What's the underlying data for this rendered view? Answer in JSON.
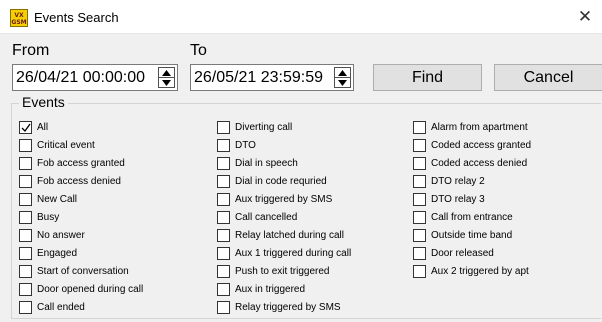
{
  "window": {
    "title": "Events Search",
    "app_icon_text": [
      "VX",
      "GSM"
    ]
  },
  "from": {
    "label": "From",
    "value": "26/04/21 00:00:00"
  },
  "to": {
    "label": "To",
    "value": "26/05/21 23:59:59"
  },
  "buttons": {
    "find": "Find",
    "cancel": "Cancel"
  },
  "events": {
    "title": "Events",
    "columns": [
      [
        {
          "label": "All",
          "checked": true
        },
        {
          "label": "Critical event",
          "checked": false
        },
        {
          "label": "Fob access granted",
          "checked": false
        },
        {
          "label": "Fob access denied",
          "checked": false
        },
        {
          "label": "New Call",
          "checked": false
        },
        {
          "label": "Busy",
          "checked": false
        },
        {
          "label": "No answer",
          "checked": false
        },
        {
          "label": "Engaged",
          "checked": false
        },
        {
          "label": "Start of conversation",
          "checked": false
        },
        {
          "label": "Door opened during call",
          "checked": false
        },
        {
          "label": "Call ended",
          "checked": false
        }
      ],
      [
        {
          "label": "Diverting call",
          "checked": false
        },
        {
          "label": "DTO",
          "checked": false
        },
        {
          "label": "Dial in speech",
          "checked": false
        },
        {
          "label": "Dial in code requried",
          "checked": false
        },
        {
          "label": "Aux triggered by SMS",
          "checked": false
        },
        {
          "label": "Call cancelled",
          "checked": false
        },
        {
          "label": "Relay latched during call",
          "checked": false
        },
        {
          "label": "Aux 1 triggered during call",
          "checked": false
        },
        {
          "label": "Push to exit triggered",
          "checked": false
        },
        {
          "label": "Aux in triggered",
          "checked": false
        },
        {
          "label": "Relay triggered by SMS",
          "checked": false
        }
      ],
      [
        {
          "label": "Alarm from apartment",
          "checked": false
        },
        {
          "label": "Coded access granted",
          "checked": false
        },
        {
          "label": "Coded access denied",
          "checked": false
        },
        {
          "label": "DTO relay 2",
          "checked": false
        },
        {
          "label": "DTO relay 3",
          "checked": false
        },
        {
          "label": "Call from entrance",
          "checked": false
        },
        {
          "label": "Outside time band",
          "checked": false
        },
        {
          "label": "Door released",
          "checked": false
        },
        {
          "label": "Aux 2 triggered by apt",
          "checked": false
        }
      ]
    ]
  }
}
